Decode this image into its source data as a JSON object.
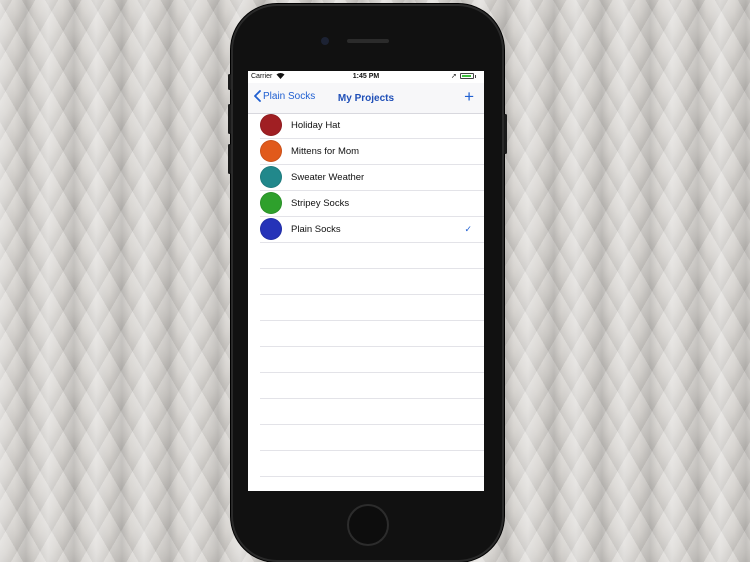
{
  "status_bar": {
    "carrier": "Carrier",
    "time": "1:45 PM",
    "battery_level": 0.9
  },
  "nav": {
    "back_label": "Plain Socks",
    "title": "My Projects",
    "add_label": "+"
  },
  "projects": [
    {
      "name": "Holiday Hat",
      "color": "#a01f23",
      "selected": false
    },
    {
      "name": "Mittens for Mom",
      "color": "#e15a1b",
      "selected": false
    },
    {
      "name": "Sweater Weather",
      "color": "#21888b",
      "selected": false
    },
    {
      "name": "Stripey Socks",
      "color": "#2ea02c",
      "selected": false
    },
    {
      "name": "Plain Socks",
      "color": "#2533b8",
      "selected": true
    }
  ],
  "checkmark": "✓"
}
